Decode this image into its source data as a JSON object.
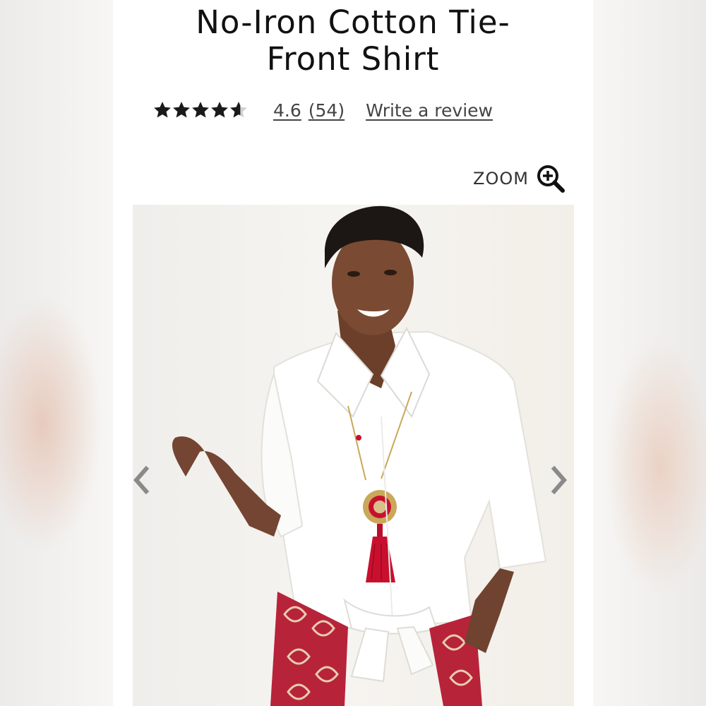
{
  "product": {
    "title_line1": "No-Iron Cotton Tie-",
    "title_line2": "Front Shirt"
  },
  "rating": {
    "value": "4.6",
    "count": "(54)",
    "stars_filled_fraction": 0.92,
    "write_review_label": "Write a review"
  },
  "zoom": {
    "label": "ZOOM",
    "icon": "zoom-in-magnifier-icon"
  },
  "gallery": {
    "image": "model-in-white-tie-front-shirt-with-red-tassel-necklace",
    "prev_icon": "chevron-left-icon",
    "next_icon": "chevron-right-icon"
  },
  "colors": {
    "text": "#111111",
    "link": "#444444",
    "arrow": "#8a8a8a",
    "accent_red": "#c8102e"
  }
}
